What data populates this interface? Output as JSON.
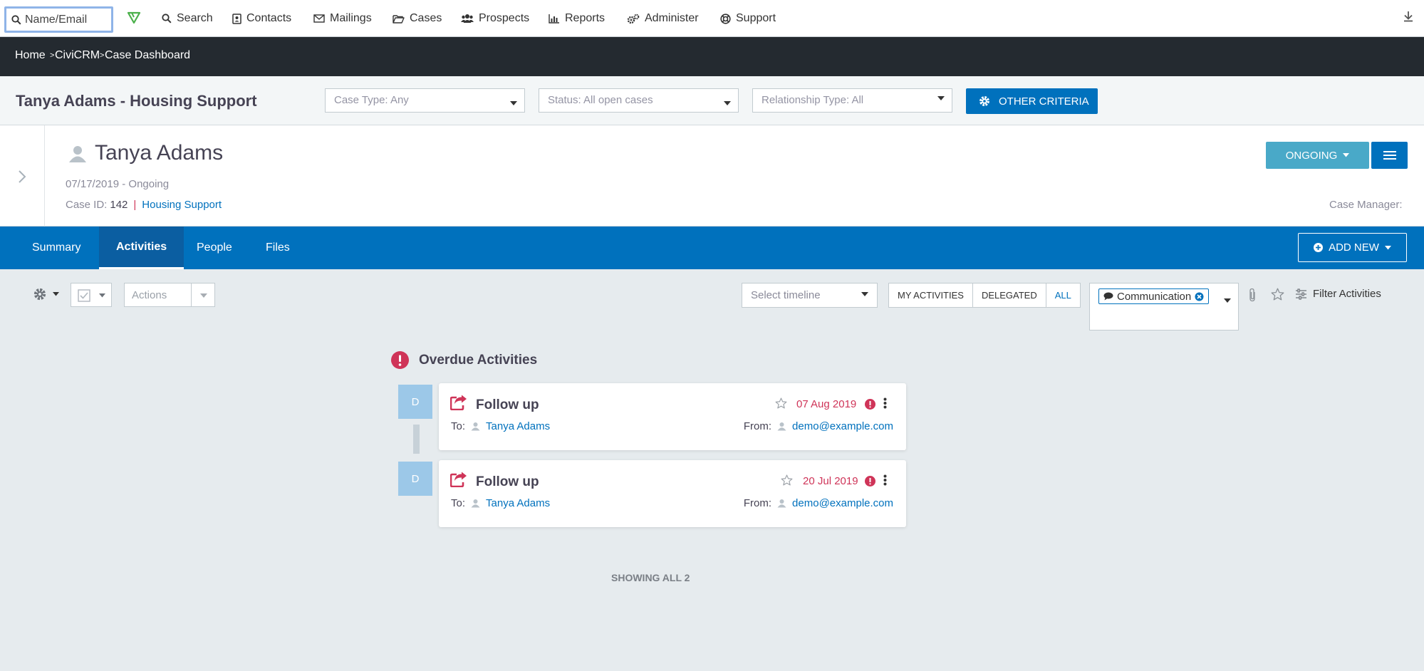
{
  "topbar": {
    "search_placeholder": "Name/Email",
    "logo_icon": "civicrm-logo-icon",
    "menu": [
      {
        "label": "Search",
        "icon": "search-icon"
      },
      {
        "label": "Contacts",
        "icon": "contact-card-icon"
      },
      {
        "label": "Mailings",
        "icon": "envelope-icon"
      },
      {
        "label": "Cases",
        "icon": "folder-open-icon"
      },
      {
        "label": "Prospects",
        "icon": "users-icon"
      },
      {
        "label": "Reports",
        "icon": "bar-chart-icon"
      },
      {
        "label": "Administer",
        "icon": "gears-icon"
      },
      {
        "label": "Support",
        "icon": "life-ring-icon"
      }
    ]
  },
  "breadcrumb": {
    "items": [
      "Home",
      "CiviCRM",
      "Case Dashboard"
    ],
    "separator": ">"
  },
  "case_header": {
    "title": "Tanya Adams - Housing Support",
    "filters": {
      "case_type": "Case Type: Any",
      "status": "Status: All open cases",
      "relationship": "Relationship Type: All"
    },
    "other_criteria_label": "OTHER CRITERIA"
  },
  "case_card": {
    "client_name": "Tanya Adams",
    "dates": "07/17/2019 - Ongoing",
    "case_id_label": "Case ID:",
    "case_id": "142",
    "case_type": "Housing Support",
    "status_button": "ONGOING",
    "case_manager_label": "Case Manager:"
  },
  "tabs": [
    {
      "label": "Summary",
      "active": false
    },
    {
      "label": "Activities",
      "active": true
    },
    {
      "label": "People",
      "active": false
    },
    {
      "label": "Files",
      "active": false
    }
  ],
  "add_new_label": "ADD NEW",
  "toolbar": {
    "actions_placeholder": "Actions",
    "timeline_placeholder": "Select timeline",
    "filter_buttons": [
      "MY ACTIVITIES",
      "DELEGATED",
      "ALL"
    ],
    "category_tag": "Communication",
    "filter_activities_label": "Filter Activities"
  },
  "overdue": {
    "heading": "Overdue Activities",
    "activities": [
      {
        "avatar": "D",
        "title": "Follow up",
        "date": "07 Aug 2019",
        "to_label": "To:",
        "to": "Tanya Adams",
        "from_label": "From:",
        "from": "demo@example.com"
      },
      {
        "avatar": "D",
        "title": "Follow up",
        "date": "20 Jul 2019",
        "to_label": "To:",
        "to": "Tanya Adams",
        "from_label": "From:",
        "from": "demo@example.com"
      }
    ]
  },
  "showing_all": "SHOWING ALL 2",
  "colors": {
    "primary": "#0071bd",
    "status_button": "#49a9c8",
    "overdue": "#cf3458",
    "navbar": "#242a30",
    "avatar": "#9cc8e8"
  }
}
